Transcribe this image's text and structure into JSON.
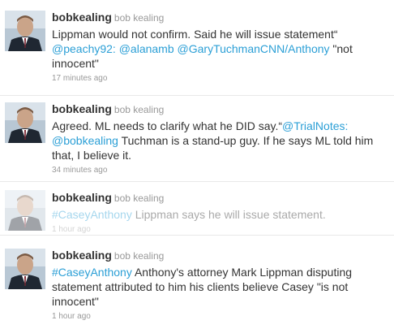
{
  "tweets": [
    {
      "screen_name": "bobkealing",
      "full_name": "bob kealing",
      "text_before": "Lippman would not confirm. Said he will issue statement“",
      "mentions": [
        "@peachy92:",
        "@alanamb",
        "@GaryTuchmanCNN/Anthony"
      ],
      "text_after": "\"not innocent\"",
      "timestamp": "17 minutes ago"
    },
    {
      "screen_name": "bobkealing",
      "full_name": "bob kealing",
      "text_before": "Agreed. ML needs to clarify what he DID say.“",
      "mentions": [
        "@TrialNotes:",
        "@bobkealing"
      ],
      "text_after": "Tuchman is a stand-up guy. If he says ML told him that, I believe it.",
      "timestamp": "34 minutes ago"
    },
    {
      "screen_name": "bobkealing",
      "full_name": "bob kealing",
      "hashtag": "#CaseyAnthony",
      "text_after": "Lippman says he will issue statement.",
      "timestamp": "1 hour ago"
    },
    {
      "screen_name": "bobkealing",
      "full_name": "bob kealing",
      "hashtag": "#CaseyAnthony",
      "text_after": "Anthony's attorney Mark Lippman disputing statement attributed to him his clients believe Casey \"is not innocent\"",
      "timestamp": "1 hour ago"
    }
  ],
  "colors": {
    "link": "#2b9fd6",
    "meta": "#999999",
    "text": "#333333"
  },
  "icons": [
    "avatar-photo"
  ]
}
